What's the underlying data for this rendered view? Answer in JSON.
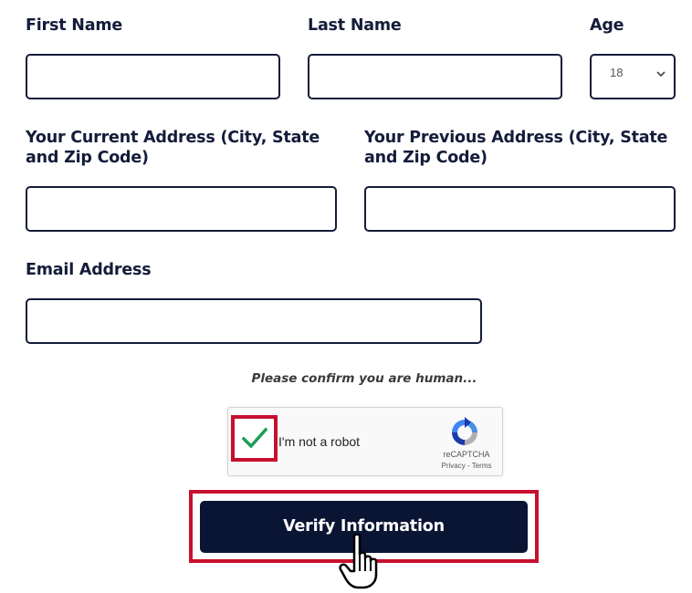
{
  "form": {
    "first_name": {
      "label": "First Name",
      "value": ""
    },
    "last_name": {
      "label": "Last Name",
      "value": ""
    },
    "age": {
      "label": "Age",
      "selected": "18"
    },
    "current_address": {
      "label": "Your Current Address (City, State and Zip Code)",
      "value": ""
    },
    "previous_address": {
      "label": "Your Previous Address (City, State and Zip Code)",
      "value": ""
    },
    "email": {
      "label": "Email Address",
      "value": ""
    }
  },
  "captcha": {
    "prompt": "Please confirm you are human...",
    "checkbox_text": "I'm not a robot",
    "checked": true,
    "brand": "reCAPTCHA",
    "links": "Privacy - Terms"
  },
  "actions": {
    "verify_label": "Verify Information"
  },
  "colors": {
    "text": "#141c3a",
    "button_bg": "#0a1433",
    "highlight": "#c8102e",
    "check": "#1e9e58"
  },
  "icons": {
    "age_dropdown": "chevron-down-icon",
    "captcha_check": "checkmark-icon",
    "captcha_logo": "recaptcha-logo-icon",
    "cursor": "hand-pointer-icon"
  }
}
